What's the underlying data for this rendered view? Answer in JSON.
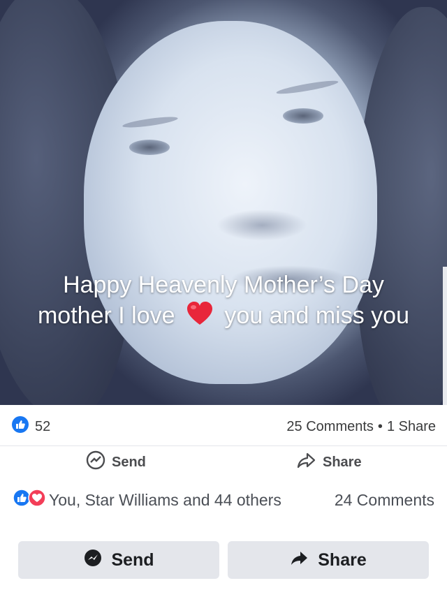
{
  "post": {
    "caption_line1": "Happy Heavenly Mother’s Day",
    "caption_line2_a": "mother I love",
    "caption_line2_b": "you and miss you",
    "heart_icon": "red-heart-emoji"
  },
  "inner_footer": {
    "like_count": "52",
    "comments": "25 Comments",
    "separator": "•",
    "shares": "1 Share",
    "send_label": "Send",
    "share_label": "Share"
  },
  "outer_footer": {
    "reactions_text": "You, Star Williams and 44 others",
    "comments": "24 Comments",
    "send_label": "Send",
    "share_label": "Share"
  },
  "colors": {
    "like_blue": "#1877f2",
    "love_red": "#f33e58",
    "button_gray": "#e4e6eb"
  }
}
